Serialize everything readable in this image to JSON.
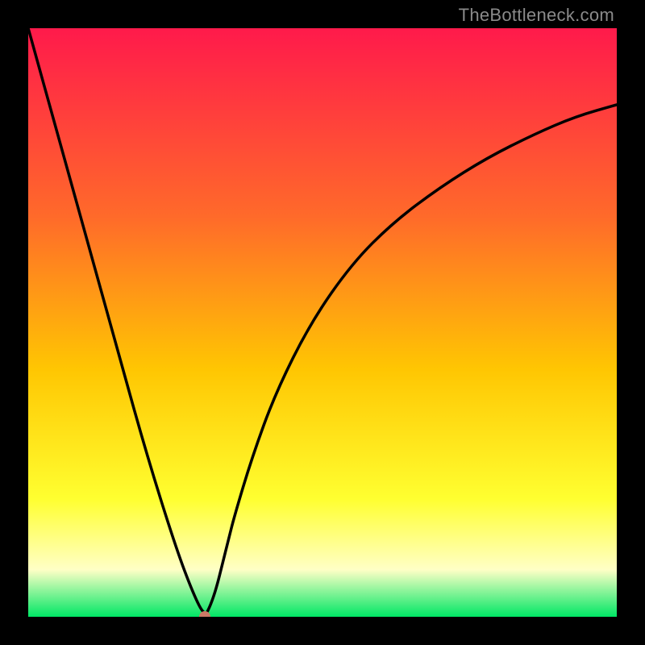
{
  "watermark": "TheBottleneck.com",
  "colors": {
    "top": "#ff1a4b",
    "mid_upper": "#ff6a2a",
    "mid": "#ffc602",
    "mid_lower": "#ffff30",
    "cream": "#ffffc6",
    "green": "#00e765",
    "curve": "#000000",
    "dot": "#cc7a66",
    "frame": "#000000"
  },
  "chart_data": {
    "type": "line",
    "title": "",
    "xlabel": "",
    "ylabel": "",
    "xlim": [
      0,
      100
    ],
    "ylim": [
      0,
      100
    ],
    "x": [
      0,
      5,
      10,
      15,
      20,
      25,
      28,
      30,
      31,
      32,
      33,
      34,
      35,
      38,
      42,
      48,
      55,
      62,
      70,
      78,
      86,
      93,
      100
    ],
    "values": [
      100,
      82,
      64,
      46,
      28,
      12,
      4,
      0,
      2,
      5,
      9,
      13,
      17,
      27,
      38,
      50,
      60,
      67,
      73,
      78,
      82,
      85,
      87
    ],
    "marker": {
      "x": 30,
      "y": 0
    },
    "annotations": [],
    "grid": false,
    "legend": false
  }
}
